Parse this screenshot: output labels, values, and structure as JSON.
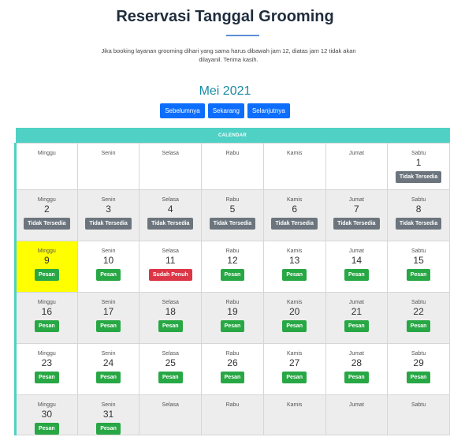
{
  "page": {
    "title": "Reservasi Tanggal Grooming",
    "note": "Jika booking layanan grooming dihari yang sama harus dibawah jam 12, diatas jam 12 tidak akan dilayanil. Terima kasih."
  },
  "calendar": {
    "month_label": "Mei 2021",
    "nav": {
      "prev": "Sebelumnya",
      "today": "Sekarang",
      "next": "Selanjutnya"
    },
    "header": "CALENDAR",
    "colors": {
      "accent": "#4fd1c5",
      "book": "#28a745",
      "unavailable": "#6c757d",
      "full": "#dc3545",
      "today_bg": "#ffff00",
      "nav": "#0d6efd"
    },
    "weeks": [
      [
        {
          "day": "Minggu",
          "date": "",
          "status": "empty",
          "label": ""
        },
        {
          "day": "Senin",
          "date": "",
          "status": "empty",
          "label": ""
        },
        {
          "day": "Selasa",
          "date": "",
          "status": "empty",
          "label": ""
        },
        {
          "day": "Rabu",
          "date": "",
          "status": "empty",
          "label": ""
        },
        {
          "day": "Kamis",
          "date": "",
          "status": "empty",
          "label": ""
        },
        {
          "day": "Jumat",
          "date": "",
          "status": "empty",
          "label": ""
        },
        {
          "day": "Sabtu",
          "date": "1",
          "status": "unavailable",
          "label": "Tidak Tersedia"
        }
      ],
      [
        {
          "day": "Minggu",
          "date": "2",
          "status": "unavailable",
          "label": "Tidak Tersedia"
        },
        {
          "day": "Senin",
          "date": "3",
          "status": "unavailable",
          "label": "Tidak Tersedia"
        },
        {
          "day": "Selasa",
          "date": "4",
          "status": "unavailable",
          "label": "Tidak Tersedia"
        },
        {
          "day": "Rabu",
          "date": "5",
          "status": "unavailable",
          "label": "Tidak Tersedia"
        },
        {
          "day": "Kamis",
          "date": "6",
          "status": "unavailable",
          "label": "Tidak Tersedia"
        },
        {
          "day": "Jumat",
          "date": "7",
          "status": "unavailable",
          "label": "Tidak Tersedia"
        },
        {
          "day": "Sabtu",
          "date": "8",
          "status": "unavailable",
          "label": "Tidak Tersedia"
        }
      ],
      [
        {
          "day": "Minggu",
          "date": "9",
          "status": "book",
          "label": "Pesan",
          "today": true
        },
        {
          "day": "Senin",
          "date": "10",
          "status": "book",
          "label": "Pesan"
        },
        {
          "day": "Selasa",
          "date": "11",
          "status": "full",
          "label": "Sudah Penuh"
        },
        {
          "day": "Rabu",
          "date": "12",
          "status": "book",
          "label": "Pesan"
        },
        {
          "day": "Kamis",
          "date": "13",
          "status": "book",
          "label": "Pesan"
        },
        {
          "day": "Jumat",
          "date": "14",
          "status": "book",
          "label": "Pesan"
        },
        {
          "day": "Sabtu",
          "date": "15",
          "status": "book",
          "label": "Pesan"
        }
      ],
      [
        {
          "day": "Minggu",
          "date": "16",
          "status": "book",
          "label": "Pesan"
        },
        {
          "day": "Senin",
          "date": "17",
          "status": "book",
          "label": "Pesan"
        },
        {
          "day": "Selasa",
          "date": "18",
          "status": "book",
          "label": "Pesan"
        },
        {
          "day": "Rabu",
          "date": "19",
          "status": "book",
          "label": "Pesan"
        },
        {
          "day": "Kamis",
          "date": "20",
          "status": "book",
          "label": "Pesan"
        },
        {
          "day": "Jumat",
          "date": "21",
          "status": "book",
          "label": "Pesan"
        },
        {
          "day": "Sabtu",
          "date": "22",
          "status": "book",
          "label": "Pesan"
        }
      ],
      [
        {
          "day": "Minggu",
          "date": "23",
          "status": "book",
          "label": "Pesan"
        },
        {
          "day": "Senin",
          "date": "24",
          "status": "book",
          "label": "Pesan"
        },
        {
          "day": "Selasa",
          "date": "25",
          "status": "book",
          "label": "Pesan"
        },
        {
          "day": "Rabu",
          "date": "26",
          "status": "book",
          "label": "Pesan"
        },
        {
          "day": "Kamis",
          "date": "27",
          "status": "book",
          "label": "Pesan"
        },
        {
          "day": "Jumat",
          "date": "28",
          "status": "book",
          "label": "Pesan"
        },
        {
          "day": "Sabtu",
          "date": "29",
          "status": "book",
          "label": "Pesan"
        }
      ],
      [
        {
          "day": "Minggu",
          "date": "30",
          "status": "book",
          "label": "Pesan"
        },
        {
          "day": "Senin",
          "date": "31",
          "status": "book",
          "label": "Pesan"
        },
        {
          "day": "Selasa",
          "date": "",
          "status": "empty",
          "label": ""
        },
        {
          "day": "Rabu",
          "date": "",
          "status": "empty",
          "label": ""
        },
        {
          "day": "Kamis",
          "date": "",
          "status": "empty",
          "label": ""
        },
        {
          "day": "Jumat",
          "date": "",
          "status": "empty",
          "label": ""
        },
        {
          "day": "Sabtu",
          "date": "",
          "status": "empty",
          "label": ""
        }
      ]
    ]
  }
}
